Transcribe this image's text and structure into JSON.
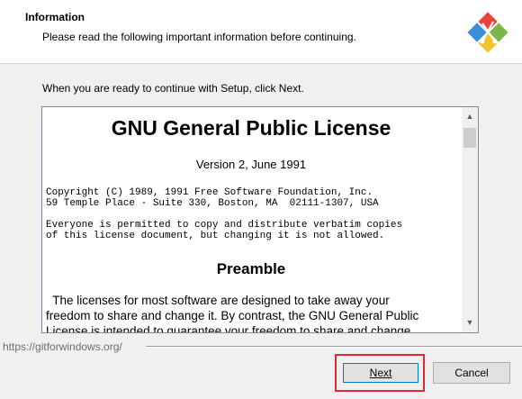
{
  "header": {
    "title": "Information",
    "subtitle": "Please read the following important information before continuing."
  },
  "instruction": "When you are ready to continue with Setup, click Next.",
  "license": {
    "title": "GNU General Public License",
    "version": "Version 2, June 1991",
    "copyright_line1": "Copyright (C) 1989, 1991 Free Software Foundation, Inc.",
    "copyright_line2": "59 Temple Place - Suite 330, Boston, MA  02111-1307, USA",
    "permission_line1": "Everyone is permitted to copy and distribute verbatim copies",
    "permission_line2": "of this license document, but changing it is not allowed.",
    "preamble_heading": "Preamble",
    "preamble_line1": "  The licenses for most software are designed to take away your",
    "preamble_line2": "freedom to share and change it. By contrast, the GNU General Public",
    "preamble_line3": "License is intended to guarantee your freedom to share and change"
  },
  "footer": {
    "url": "https://gitforwindows.org/",
    "next_label": "Next",
    "cancel_label": "Cancel"
  },
  "colors": {
    "highlight": "#e0282e",
    "focus_border": "#0078d7"
  }
}
